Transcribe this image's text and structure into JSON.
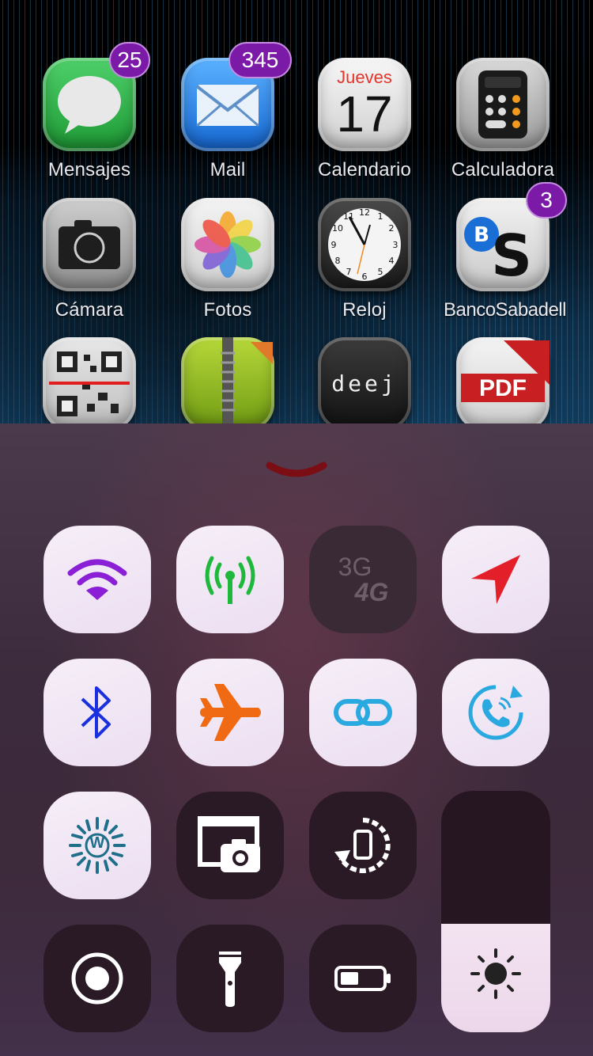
{
  "home_screen": {
    "apps": [
      {
        "label": "Mensajes",
        "badge": "25",
        "icon": "messages-icon"
      },
      {
        "label": "Mail",
        "badge": "345",
        "icon": "mail-icon"
      },
      {
        "label": "Calendario",
        "badge": null,
        "icon": "calendar-icon",
        "day_name": "Jueves",
        "day_number": "17"
      },
      {
        "label": "Calculadora",
        "badge": null,
        "icon": "calculator-icon"
      },
      {
        "label": "Cámara",
        "badge": null,
        "icon": "camera-icon"
      },
      {
        "label": "Fotos",
        "badge": null,
        "icon": "photos-icon"
      },
      {
        "label": "Reloj",
        "badge": null,
        "icon": "clock-icon"
      },
      {
        "label": "BancoSabadell",
        "badge": "3",
        "icon": "banco-sabadell-icon"
      },
      {
        "label": "",
        "badge": null,
        "icon": "qr-scanner-icon"
      },
      {
        "label": "",
        "badge": null,
        "icon": "zip-icon"
      },
      {
        "label": "",
        "badge": null,
        "icon": "deej-icon",
        "text": "deej"
      },
      {
        "label": "",
        "badge": null,
        "icon": "pdf-icon",
        "text": "PDF"
      }
    ]
  },
  "control_center": {
    "toggles": [
      {
        "name": "wifi",
        "state": "on",
        "color": "#8a1fd6"
      },
      {
        "name": "cellular-data",
        "state": "on",
        "color": "#1db83c"
      },
      {
        "name": "3g-4g",
        "state": "off",
        "text_top": "3G",
        "text_bottom": "4G"
      },
      {
        "name": "location",
        "state": "on",
        "color": "#e3202a"
      },
      {
        "name": "bluetooth",
        "state": "on",
        "color": "#1a2fe0"
      },
      {
        "name": "airplane-mode",
        "state": "on",
        "color": "#f06a14"
      },
      {
        "name": "link",
        "state": "on",
        "color": "#2aa9e0"
      },
      {
        "name": "call",
        "state": "on",
        "color": "#2aa9e0"
      },
      {
        "name": "wallpaper",
        "state": "on",
        "color": "#1f6f8a",
        "text": "W"
      },
      {
        "name": "screenshot",
        "state": "off"
      },
      {
        "name": "rotation-lock",
        "state": "off"
      },
      {
        "name": "screen-record",
        "state": "off"
      },
      {
        "name": "flashlight",
        "state": "off"
      },
      {
        "name": "battery",
        "state": "off"
      }
    ],
    "brightness_level": 0.45
  }
}
